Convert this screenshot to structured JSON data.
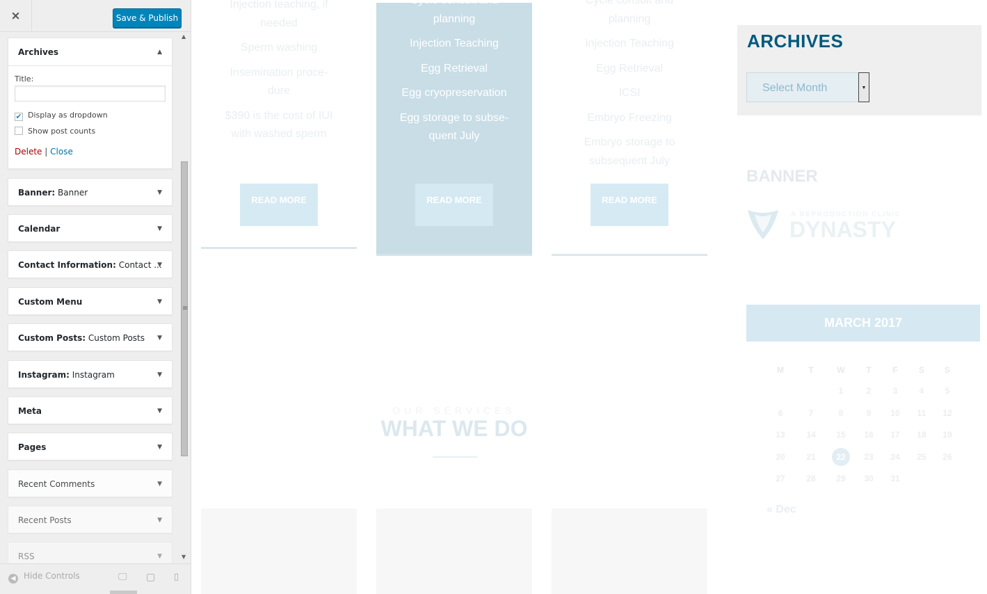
{
  "customizer": {
    "close_label": "×",
    "save_label": "Save & Publish",
    "hide_controls_label": "Hide Controls"
  },
  "widgets": [
    {
      "name": "Archives",
      "subtitle": "",
      "open": true
    },
    {
      "name": "Banner:",
      "subtitle": "Banner"
    },
    {
      "name": "Calendar",
      "subtitle": ""
    },
    {
      "name": "Contact Information:",
      "subtitle": "Contact ..."
    },
    {
      "name": "Custom Menu",
      "subtitle": ""
    },
    {
      "name": "Custom Posts:",
      "subtitle": "Custom Posts"
    },
    {
      "name": "Instagram:",
      "subtitle": "Instagram"
    },
    {
      "name": "Meta",
      "subtitle": ""
    },
    {
      "name": "Pages",
      "subtitle": ""
    },
    {
      "name": "Recent Comments",
      "subtitle": ""
    },
    {
      "name": "Recent Posts",
      "subtitle": ""
    },
    {
      "name": "RSS",
      "subtitle": ""
    }
  ],
  "archives_form": {
    "title_label": "Title:",
    "title_value": "",
    "dropdown_label": "Display as dropdown",
    "dropdown_checked": true,
    "counts_label": "Show post counts",
    "counts_checked": false,
    "delete_label": "Delete",
    "separator": "|",
    "close_label": "Close"
  },
  "pricing": [
    {
      "items": [
        "Injection teaching, if needed",
        "Sperm washing",
        "Insemination proce- dure",
        "$390 is the cost of IUI with washed sperm"
      ],
      "button": "READ MORE"
    },
    {
      "items": [
        "Cycle consult and planning",
        "Injection Teaching",
        "Egg Retrieval",
        "Egg cryopreservation",
        "Egg storage to subse- quent July"
      ],
      "button": "READ MORE"
    },
    {
      "items": [
        "Cycle consult and planning",
        "Injection Teaching",
        "Egg Retrieval",
        "ICSI",
        "Embryo Freezing",
        "Embryo storage to subsequent July"
      ],
      "button": "READ MORE"
    }
  ],
  "services": {
    "subtitle": "OUR SERVICES",
    "title": "WHAT WE DO"
  },
  "archives_widget": {
    "title": "ARCHIVES",
    "select_label": "Select Month"
  },
  "banner_widget": {
    "title": "BANNER",
    "logo_tagline": "A REPRODUCTION CLINIC",
    "logo_name": "DYNASTY"
  },
  "calendar": {
    "month": "MARCH 2017",
    "days_of_week": [
      "M",
      "T",
      "W",
      "T",
      "F",
      "S",
      "S"
    ],
    "weeks": [
      [
        "",
        "",
        "1",
        "2",
        "3",
        "4",
        "5"
      ],
      [
        "6",
        "7",
        "8",
        "9",
        "10",
        "11",
        "12"
      ],
      [
        "13",
        "14",
        "15",
        "16",
        "17",
        "18",
        "19"
      ],
      [
        "20",
        "21",
        "22",
        "23",
        "24",
        "25",
        "26"
      ],
      [
        "27",
        "28",
        "29",
        "30",
        "31",
        "",
        ""
      ]
    ],
    "today": "22",
    "prev_label": "« Dec"
  },
  "colors": {
    "primary": "#0085ba",
    "archives_title": "#005a7d",
    "delete": "#aa0000",
    "link": "#0073aa"
  }
}
